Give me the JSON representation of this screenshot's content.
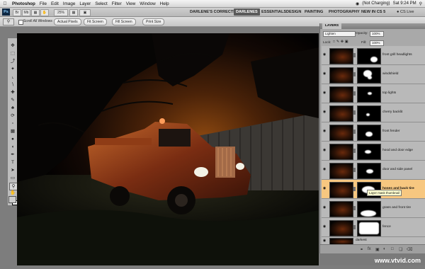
{
  "menubar": {
    "app": "Photoshop",
    "items": [
      "File",
      "Edit",
      "Image",
      "Layer",
      "Select",
      "Filter",
      "View",
      "Window",
      "Help"
    ],
    "battery": "(Not Charging)",
    "clock": "Sat 9:24 PM"
  },
  "appbar": {
    "logo": "Ps",
    "zoom": "25%",
    "workspaces": [
      "DARLENE'S CORRECTED",
      "DARLENES",
      "ESSENTIALS",
      "DESIGN",
      "PAINTING",
      "PHOTOGRAPHY",
      "NEW IN CS 5"
    ],
    "active_workspace": "DARLENES",
    "cs_live": "CS Live"
  },
  "options": {
    "checkbox_label": "Scroll All Windows",
    "buttons": [
      "Actual Pixels",
      "Fit Screen",
      "Fill Screen",
      "Print Size"
    ]
  },
  "layers": {
    "tab": "LAYERS",
    "blend_mode": "Lighten",
    "opacity_label": "Opacity:",
    "opacity": "100%",
    "lock_label": "Lock:",
    "fill_label": "Fill:",
    "fill": "100%",
    "items": [
      {
        "name": "front grill headlights",
        "selected": false
      },
      {
        "name": "windshield",
        "selected": false
      },
      {
        "name": "top lights",
        "selected": false
      },
      {
        "name": "cherry backlit",
        "selected": false
      },
      {
        "name": "front fender",
        "selected": false
      },
      {
        "name": "hood and door edge",
        "selected": false
      },
      {
        "name": "door and side panel",
        "selected": false
      },
      {
        "name": "hoses and back tire",
        "selected": true
      },
      {
        "name": "grass and front tire",
        "selected": false
      },
      {
        "name": "fence",
        "selected": false
      },
      {
        "name": "darkest",
        "selected": false
      }
    ],
    "tooltip": "Layer mask thumbnail"
  },
  "colors": {
    "selected_layer": "#f7c780",
    "panel": "#a9a9a9",
    "canvas": "#030303"
  },
  "watermark": "www.vtvid.com"
}
